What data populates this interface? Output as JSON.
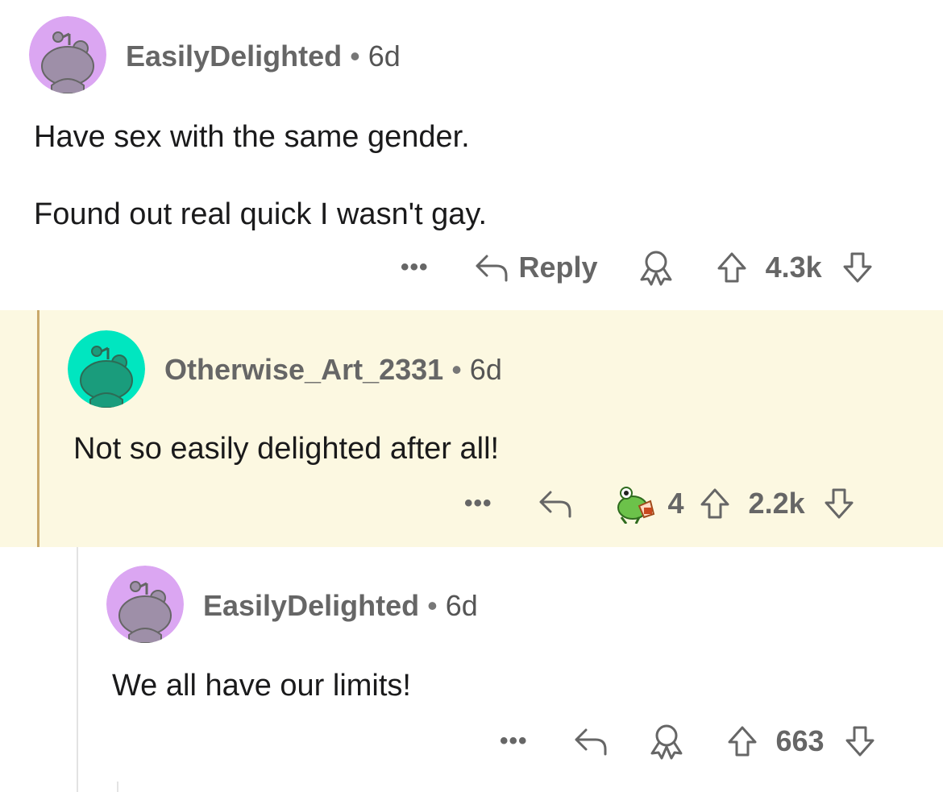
{
  "comments": [
    {
      "username": "EasilyDelighted",
      "age": "6d",
      "avatar_bg": "#dba6f2",
      "lines": [
        "Have sex with the same gender.",
        "Found out real quick I wasn't gay."
      ],
      "reply_label": "Reply",
      "upvotes": "4.3k"
    },
    {
      "username": "Otherwise_Art_2331",
      "age": "6d",
      "avatar_bg": "#00e6c0",
      "lines": [
        "Not so easily delighted after all!"
      ],
      "award_count": "4",
      "upvotes": "2.2k",
      "highlight_color": "#fcf8e1"
    },
    {
      "username": "EasilyDelighted",
      "age": "6d",
      "avatar_bg": "#dba6f2",
      "lines": [
        "We all have our limits!"
      ],
      "upvotes": "663"
    }
  ],
  "separator": "•",
  "more_glyph": "•••",
  "icons": {
    "more": "more-dots-icon",
    "reply": "reply-arrow-icon",
    "award": "award-icon",
    "award_emoji": "frog-drinking-award-icon",
    "upvote": "upvote-arrow-icon",
    "downvote": "downvote-arrow-icon"
  }
}
